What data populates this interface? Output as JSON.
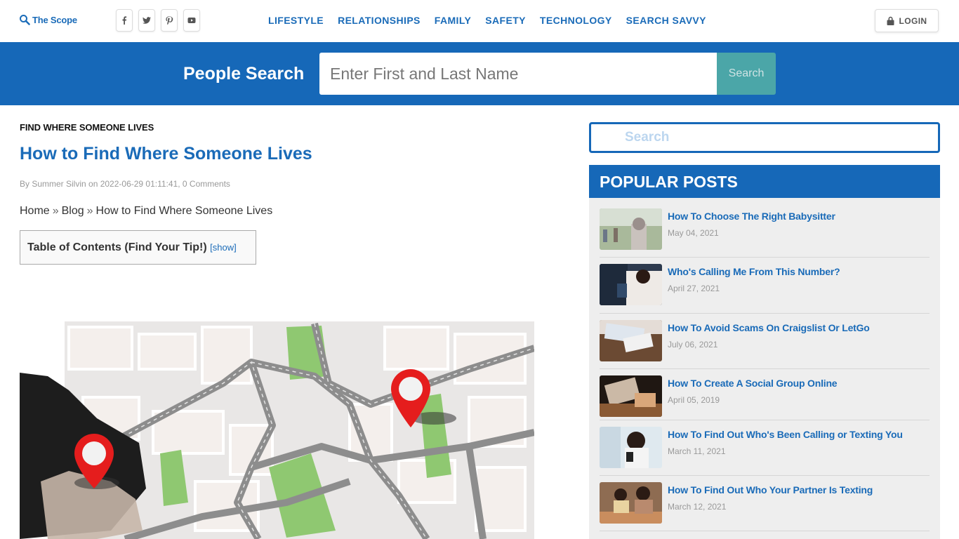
{
  "brand": {
    "name": "The Scope",
    "accent": "#1668b8",
    "button_teal": "#4ba6a8"
  },
  "social": [
    {
      "name": "facebook",
      "glyph": "f"
    },
    {
      "name": "twitter",
      "glyph": "t"
    },
    {
      "name": "pinterest",
      "glyph": "p"
    },
    {
      "name": "youtube",
      "glyph": "yt"
    }
  ],
  "menu": [
    "LIFESTYLE",
    "RELATIONSHIPS",
    "FAMILY",
    "SAFETY",
    "TECHNOLOGY",
    "SEARCH SAVVY"
  ],
  "login_label": "LOGIN",
  "people_search": {
    "title": "People Search",
    "placeholder": "Enter First and Last Name",
    "button": "Search"
  },
  "article": {
    "category": "FIND WHERE SOMEONE LIVES",
    "title": "How to Find Where Someone Lives",
    "meta": "By Summer Silvin on 2022-06-29 01:11:41, 0 Comments",
    "breadcrumb": [
      "Home",
      "Blog",
      "How to Find Where Someone Lives"
    ],
    "breadcrumb_sep": "»",
    "toc_label": "Table of Contents (Find Your Tip!)",
    "toc_toggle": "[show]"
  },
  "sidebar": {
    "search_placeholder": "Search",
    "popular_title": "POPULAR POSTS",
    "posts": [
      {
        "title": "How To Choose The Right Babysitter",
        "date": "May 04, 2021"
      },
      {
        "title": "Who's Calling Me From This Number?",
        "date": "April 27, 2021"
      },
      {
        "title": "How To Avoid Scams On Craigslist Or LetGo",
        "date": "July 06, 2021"
      },
      {
        "title": "How To Create A Social Group Online",
        "date": "April 05, 2019"
      },
      {
        "title": "How To Find Out Who's Been Calling or Texting You",
        "date": "March 11, 2021"
      },
      {
        "title": "How To Find Out Who Your Partner Is Texting",
        "date": "March 12, 2021"
      }
    ]
  }
}
